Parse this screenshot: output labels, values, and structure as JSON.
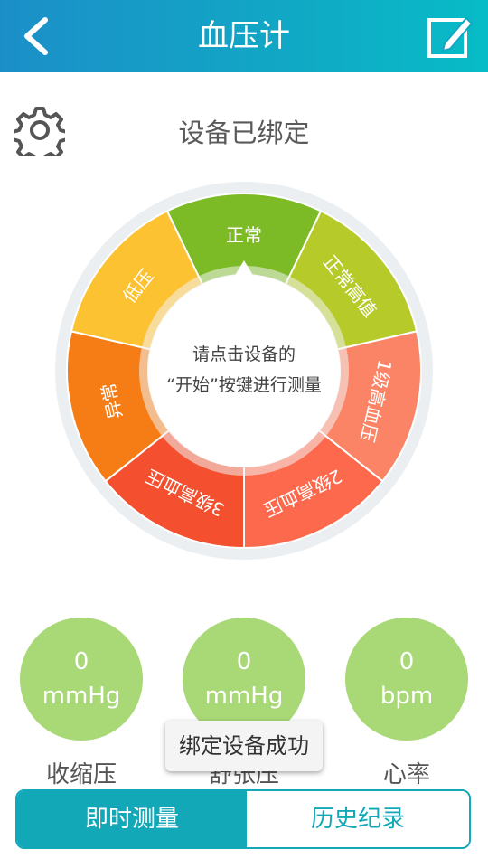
{
  "header": {
    "title": "血压计"
  },
  "status": {
    "text": "设备已绑定"
  },
  "gauge": {
    "center_line1": "请点击设备的",
    "center_line2": "“开始”按键进行测量",
    "segments": [
      {
        "label": "正常",
        "color": "#7cbb26"
      },
      {
        "label": "正常高值",
        "color": "#b6cb2a"
      },
      {
        "label": "1级高血压",
        "color": "#fb8466"
      },
      {
        "label": "2级高血压",
        "color": "#fd694c"
      },
      {
        "label": "3级高血压",
        "color": "#f4502f"
      },
      {
        "label": "异常",
        "color": "#f67d16"
      },
      {
        "label": "低压",
        "color": "#fcc232"
      }
    ]
  },
  "metrics": [
    {
      "value": "0",
      "unit": "mmHg",
      "label": "收缩压"
    },
    {
      "value": "0",
      "unit": "mmHg",
      "label": "舒张压"
    },
    {
      "value": "0",
      "unit": "bpm",
      "label": "心率"
    }
  ],
  "toast": {
    "text": "绑定设备成功"
  },
  "tabs": {
    "active": "即时测量",
    "inactive": "历史纪录"
  },
  "colors": {
    "header": "#12a6c5",
    "accent": "#13a8b8",
    "metric_bg": "#a9d877"
  },
  "icons": {
    "back": "chevron-left-icon",
    "edit": "edit-icon",
    "settings": "gear-icon"
  }
}
